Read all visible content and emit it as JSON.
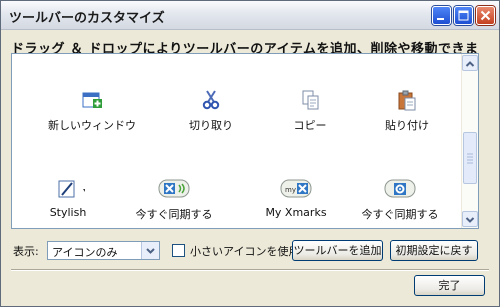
{
  "window": {
    "title": "ツールバーのカスタマイズ"
  },
  "instruction": "ドラッグ ＆ ドロップによりツールバーのアイテムを追加、削除や移動できます。",
  "items": [
    {
      "label": "新しいウィンドウ",
      "icon": "new-window-icon"
    },
    {
      "label": "切り取り",
      "icon": "scissors-icon"
    },
    {
      "label": "コピー",
      "icon": "copy-icon"
    },
    {
      "label": "貼り付け",
      "icon": "paste-icon"
    },
    {
      "label": "Stylish",
      "icon": "stylish-icon"
    },
    {
      "label": "今すぐ同期する",
      "icon": "xmarks-sync-icon"
    },
    {
      "label": "My Xmarks",
      "icon": "my-xmarks-icon"
    },
    {
      "label": "今すぐ同期する",
      "icon": "sync-gear-icon"
    }
  ],
  "footer": {
    "show_label": "表示:",
    "show_value": "アイコンのみ",
    "small_icons_label": "小さいアイコンを使用",
    "add_toolbar_label": "ツールバーを追加",
    "reset_label": "初期設定に戻す",
    "done_label": "完了"
  },
  "colors": {
    "window_bg": "#ece9d8",
    "title_button_blue": "#2d63e0",
    "title_button_red": "#d4502b",
    "panel_border": "#7f9db9",
    "button_border": "#003c74"
  }
}
